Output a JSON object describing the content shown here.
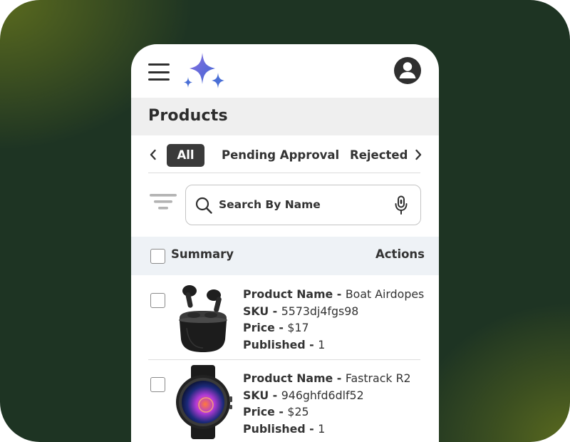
{
  "header": {
    "menu_icon": "hamburger-menu-icon",
    "logo_icon": "sparkle-logo-icon",
    "profile_icon": "user-avatar-icon"
  },
  "page": {
    "title": "Products"
  },
  "tabs": {
    "items": [
      {
        "label": "All",
        "active": true
      },
      {
        "label": "Pending Approval",
        "active": false
      },
      {
        "label": "Rejected",
        "active": false
      }
    ]
  },
  "search": {
    "placeholder": "Search By Name",
    "value": ""
  },
  "table": {
    "columns": {
      "summary": "Summary",
      "actions": "Actions"
    },
    "labels": {
      "product_name": "Product Name - ",
      "sku": "SKU - ",
      "price": "Price - ",
      "published": "Published - "
    },
    "rows": [
      {
        "product_name": "Boat Airdopes",
        "sku": "5573dj4fgs98",
        "price": "$17",
        "published": "1",
        "thumbnail": "earbuds-image"
      },
      {
        "product_name": "Fastrack R2",
        "sku": "946ghfd6dlf52",
        "price": "$25",
        "published": "1",
        "thumbnail": "smartwatch-image"
      }
    ]
  },
  "colors": {
    "background_dark": "#1e3423",
    "background_accent": "#5a6a1e",
    "active_tab": "#3a3a3a",
    "table_header": "#eef2f6",
    "title_bar": "#efefef",
    "logo_blue": "#4a6fd6",
    "logo_purple": "#7b6ad8"
  }
}
